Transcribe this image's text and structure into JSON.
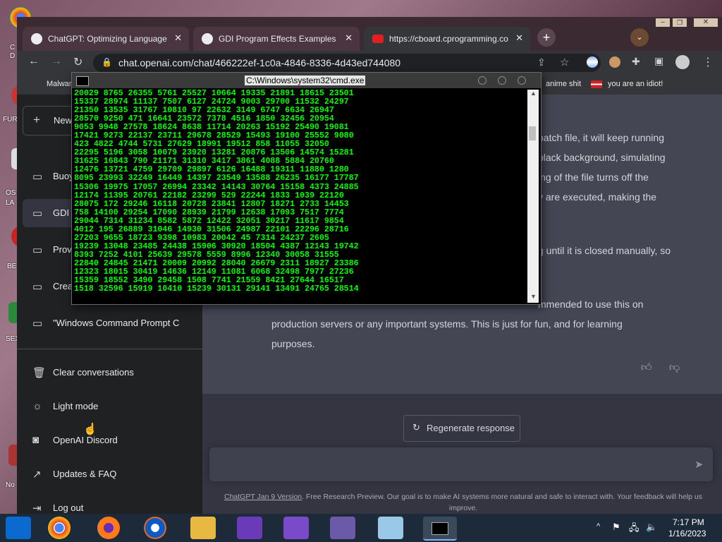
{
  "desktop": {
    "labels": [
      "C",
      "D",
      "FUR",
      "OS",
      "LA",
      "BE",
      "SEX",
      "No"
    ]
  },
  "browser": {
    "tabs": [
      {
        "label": "ChatGPT: Optimizing Language M",
        "icon": "chatgpt-icon"
      },
      {
        "label": "GDI Program Effects Examples",
        "icon": "chatgpt-icon"
      },
      {
        "label": "https://cboard.cprogramming.co",
        "icon": "youtube-icon"
      }
    ],
    "url": "chat.openai.com/chat/466222ef-1c0a-4846-8336-4d43ed744080",
    "bookmarks": {
      "left": "Malwar",
      "right1": "anime shit",
      "right2": "you are an idiot!"
    }
  },
  "sidebar": {
    "new_chat": "New",
    "conversations": [
      "Buoy",
      "GDI",
      "Prov",
      "Crea",
      "\"Windows Command Prompt C"
    ],
    "actions": [
      "Clear conversations",
      "Light mode",
      "OpenAI Discord",
      "Updates & FAQ",
      "Log out"
    ]
  },
  "answer": {
    "lines": [
      "batch file, it will keep running",
      "black background, simulating",
      "ing of the file turns off the",
      "y are executed, making the",
      "g until it is closed manually, so",
      "mmended to use this on",
      "production servers or any important systems. This is just for fun, and for learning",
      "purposes."
    ]
  },
  "regenerate_label": "Regenerate response",
  "footer": {
    "link": "ChatGPT Jan 9 Version",
    "text": ". Free Research Preview. Our goal is to make AI systems more natural and safe to interact with. Your feedback will help us improve."
  },
  "cmd": {
    "title": "C:\\Windows\\system32\\cmd.exe",
    "output": "20029 8765 26355 5761 25527 10664 19335 21891 18615 23501\n15337 28974 11137 7507 6127 24724 9003 29700 11532 24297\n21350 13535 31767 10810 97 22632 3149 6747 6634 26947\n28570 9250 471 16641 23572 7378 4516 1850 32456 20954\n9053 9948 27578 18624 8638 11714 20263 15192 25490 19081\n17421 9273 22137 23711 29678 28529 15493 19100 25552 9080\n423 4822 4744 5731 27629 18991 19512 858 11055 32050\n22295 5196 3058 10079 23920 13281 20876 13506 14574 15281\n31625 16843 790 21171 31310 3417 3861 4088 5884 20760\n12476 13721 4759 29709 29897 6126 16488 19311 11880 1280\n8095 23993 32249 16449 14397 23549 13588 26235 16177 17787\n15306 19975 17057 26994 23342 14143 30764 15158 4373 24885\n12174 11395 20761 22182 23299 529 22244 1833 1039 22120\n28075 172 29246 16118 20728 23841 12807 18271 2733 14453\n758 14100 29254 17090 28939 21799 12638 17093 7517 7774\n29044 7314 31234 8582 5872 12422 32051 30217 11617 9854\n4012 195 26889 31046 14930 31506 24987 22101 22296 28716\n27203 9655 18723 9398 10983 20042 45 7314 24237 2605\n19239 13048 23485 24438 15906 30920 18504 4387 12143 19742\n8393 7252 4101 25639 29578 5559 8996 12340 30058 31555\n22840 24845 21471 20009 20992 28040 26679 2311 18927 23386\n12323 18015 30419 14636 12149 11081 6068 32498 7977 27236\n15359 18552 3490 29458 1508 7741 21559 8421 27644 16517\n1518 32596 15919 10410 15239 30131 29141 13491 24765 28514"
  },
  "taskbar": {
    "time": "7:17 PM",
    "date": "1/16/2023"
  }
}
